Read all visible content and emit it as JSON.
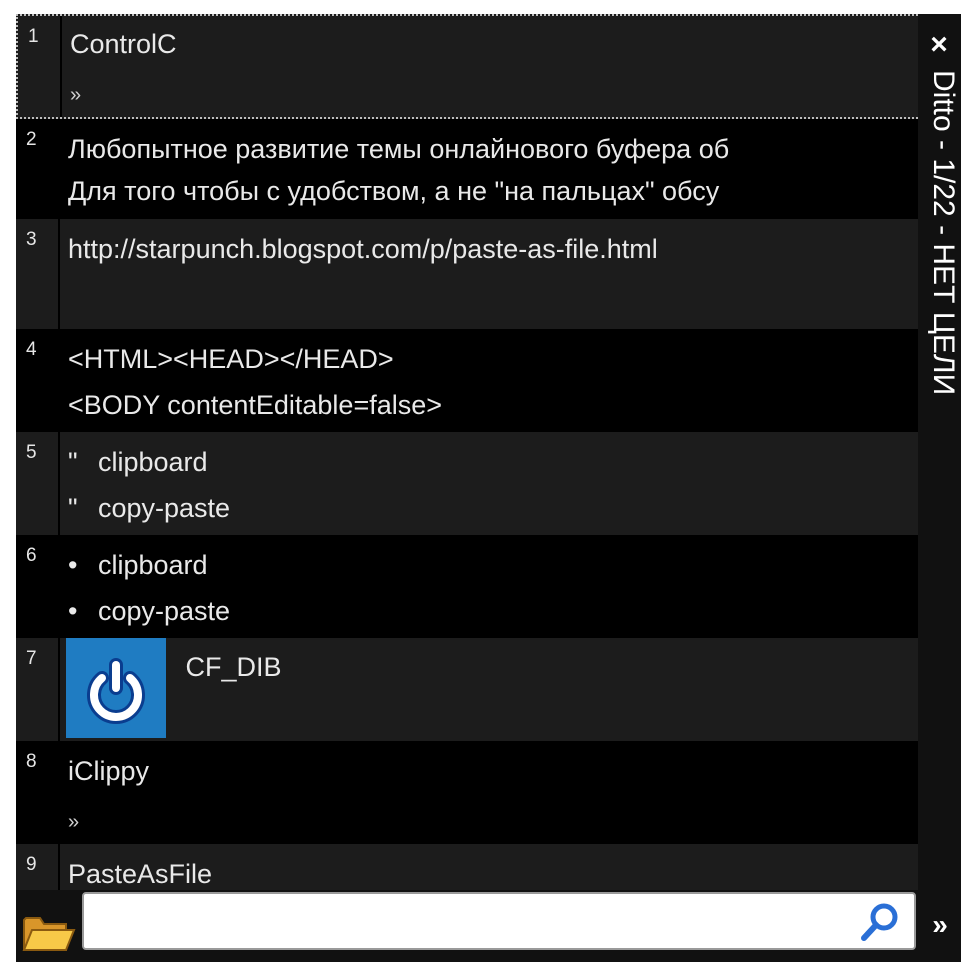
{
  "window": {
    "title": "Ditto - 1/22 - НЕТ ЦЕЛИ"
  },
  "sidebar": {
    "close_label": "×",
    "expand_label": "»"
  },
  "clips": [
    {
      "num": "1",
      "lines": [
        "ControlC"
      ],
      "more": "»"
    },
    {
      "num": "2",
      "lines": [
        "Любопытное развитие темы онлайнового буфера об",
        "Для того чтобы с удобством, а не \"на пальцах\" обсу"
      ]
    },
    {
      "num": "3",
      "lines": [
        "http://starpunch.blogspot.com/p/paste-as-file.html"
      ]
    },
    {
      "num": "4",
      "lines": [
        "<HTML><HEAD></HEAD>",
        "<BODY contentEditable=false>"
      ]
    },
    {
      "num": "5",
      "bullets": [
        "\"",
        "\""
      ],
      "lines": [
        "clipboard",
        "copy-paste"
      ]
    },
    {
      "num": "6",
      "bullets": [
        "•",
        "•"
      ],
      "lines": [
        "clipboard",
        "copy-paste"
      ]
    },
    {
      "num": "7",
      "image_label": "CF_DIB",
      "image_icon": "power-icon"
    },
    {
      "num": "8",
      "lines": [
        "iClippy"
      ],
      "more": "»"
    },
    {
      "num": "9",
      "lines": [
        "PasteAsFile"
      ]
    }
  ],
  "search": {
    "placeholder": "",
    "value": ""
  },
  "colors": {
    "background": "#000000",
    "row_alt": "#1c1c1c",
    "text": "#e9e9e9",
    "image_blue": "#1f7cc2",
    "folder_yellow": "#f2b632",
    "search_blue": "#2a6fd6"
  }
}
